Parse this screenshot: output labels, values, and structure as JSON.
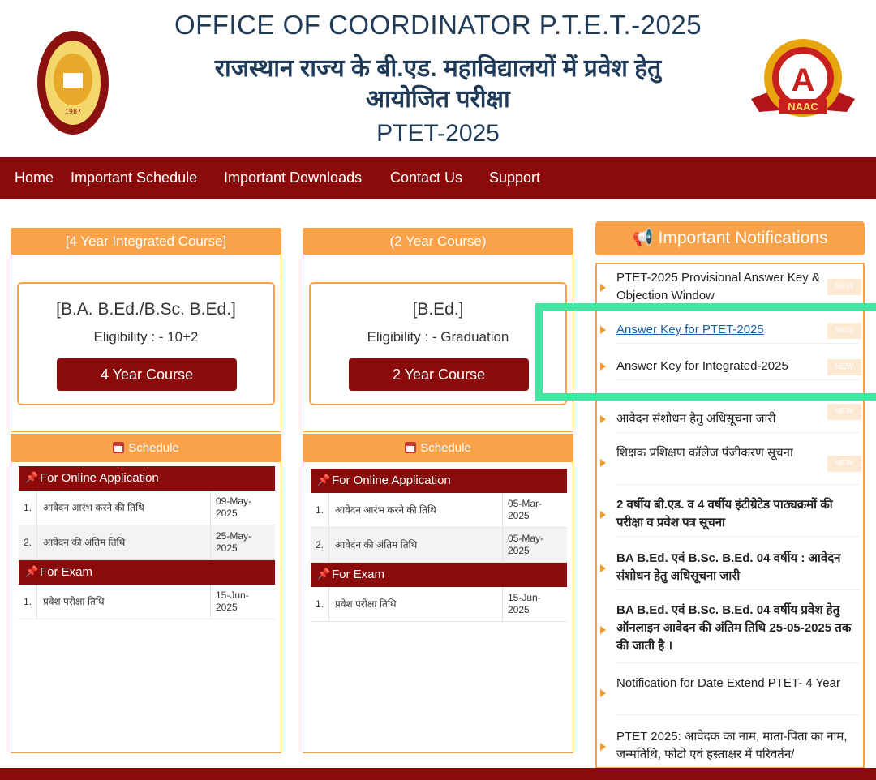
{
  "header": {
    "title_en": "OFFICE OF COORDINATOR P.T.E.T.-2025",
    "title_hi_line1": "राजस्थान राज्य के बी.एड. महाविद्यालयों में प्रवेश हेतु",
    "title_hi_line2": "आयोजित परीक्षा",
    "subtitle": "PTET-2025",
    "logo_left_year": "1987",
    "logo_right_letter": "A",
    "logo_right_text": "NAAC"
  },
  "nav": {
    "items": [
      "Home",
      "Important Schedule",
      "Important Downloads",
      "Contact Us",
      "Support"
    ]
  },
  "courses": [
    {
      "header": "[4 Year Integrated Course]",
      "name": "[B.A. B.Ed./B.Sc. B.Ed.]",
      "eligibility": "Eligibility : - 10+2",
      "button": "4 Year Course",
      "schedule_label": "Schedule",
      "online_label": "For Online Application",
      "online_rows": [
        {
          "n": "1.",
          "t": "आवेदन आरंभ करने की तिथि",
          "d": "09-May-\n2025"
        },
        {
          "n": "2.",
          "t": "आवेदन की अंतिम तिथि",
          "d": "25-May-\n2025"
        }
      ],
      "exam_label": "For Exam",
      "exam_rows": [
        {
          "n": "1.",
          "t": "प्रवेश परीक्षा तिथि",
          "d": "15-Jun-\n2025"
        }
      ]
    },
    {
      "header": "(2 Year Course)",
      "name": "[B.Ed.]",
      "eligibility": "Eligibility : - Graduation",
      "button": "2 Year Course",
      "schedule_label": "Schedule",
      "online_label": "For Online Application",
      "online_rows": [
        {
          "n": "1.",
          "t": "आवेदन आरंभ करने की तिथि",
          "d": "05-Mar-\n2025"
        },
        {
          "n": "2.",
          "t": "आवेदन की अंतिम तिथि",
          "d": "05-May-\n2025"
        }
      ],
      "exam_label": "For Exam",
      "exam_rows": [
        {
          "n": "1.",
          "t": "प्रवेश परीक्षा तिथि",
          "d": "15-Jun-\n2025"
        }
      ]
    }
  ],
  "notifications": {
    "title": "📢 Important Notifications",
    "new_label": "NEW",
    "items": [
      "PTET-2025 Provisional Answer Key & Objection Window",
      "Answer Key for PTET-2025",
      "Answer Key for Integrated-2025",
      "आवेदन संशोधन हेतु अधिसूचना जारी",
      "शिक्षक प्रशिक्षण कॉलेज पंजीकरण सूचना",
      "2 वर्षीय बी.एड. व 4 वर्षीय इंटीग्रेटेड पाठ्यक्रमों की परीक्षा व प्रवेश पत्र सूचना",
      "BA B.Ed. एवं B.Sc. B.Ed. 04 वर्षीय : आवेदन संशोधन हेतु अधिसूचना जारी",
      "BA B.Ed. एवं B.Sc. B.Ed. 04 वर्षीय प्रवेश हेतु ऑनलाइन आवेदन की अंतिम तिथि 25-05-2025 तक की जाती है ।",
      "Notification for Date Extend PTET- 4 Year",
      "PTET 2025: आवेदक का नाम, माता-पिता का नाम, जन्मतिथि, फोटो एवं हस्ताक्षर में परिवर्तन/"
    ]
  },
  "colors": {
    "maroon": "#8b0b0b",
    "orange": "#f9a24a",
    "navy": "#1f3b57",
    "highlight": "#42e6a3"
  }
}
